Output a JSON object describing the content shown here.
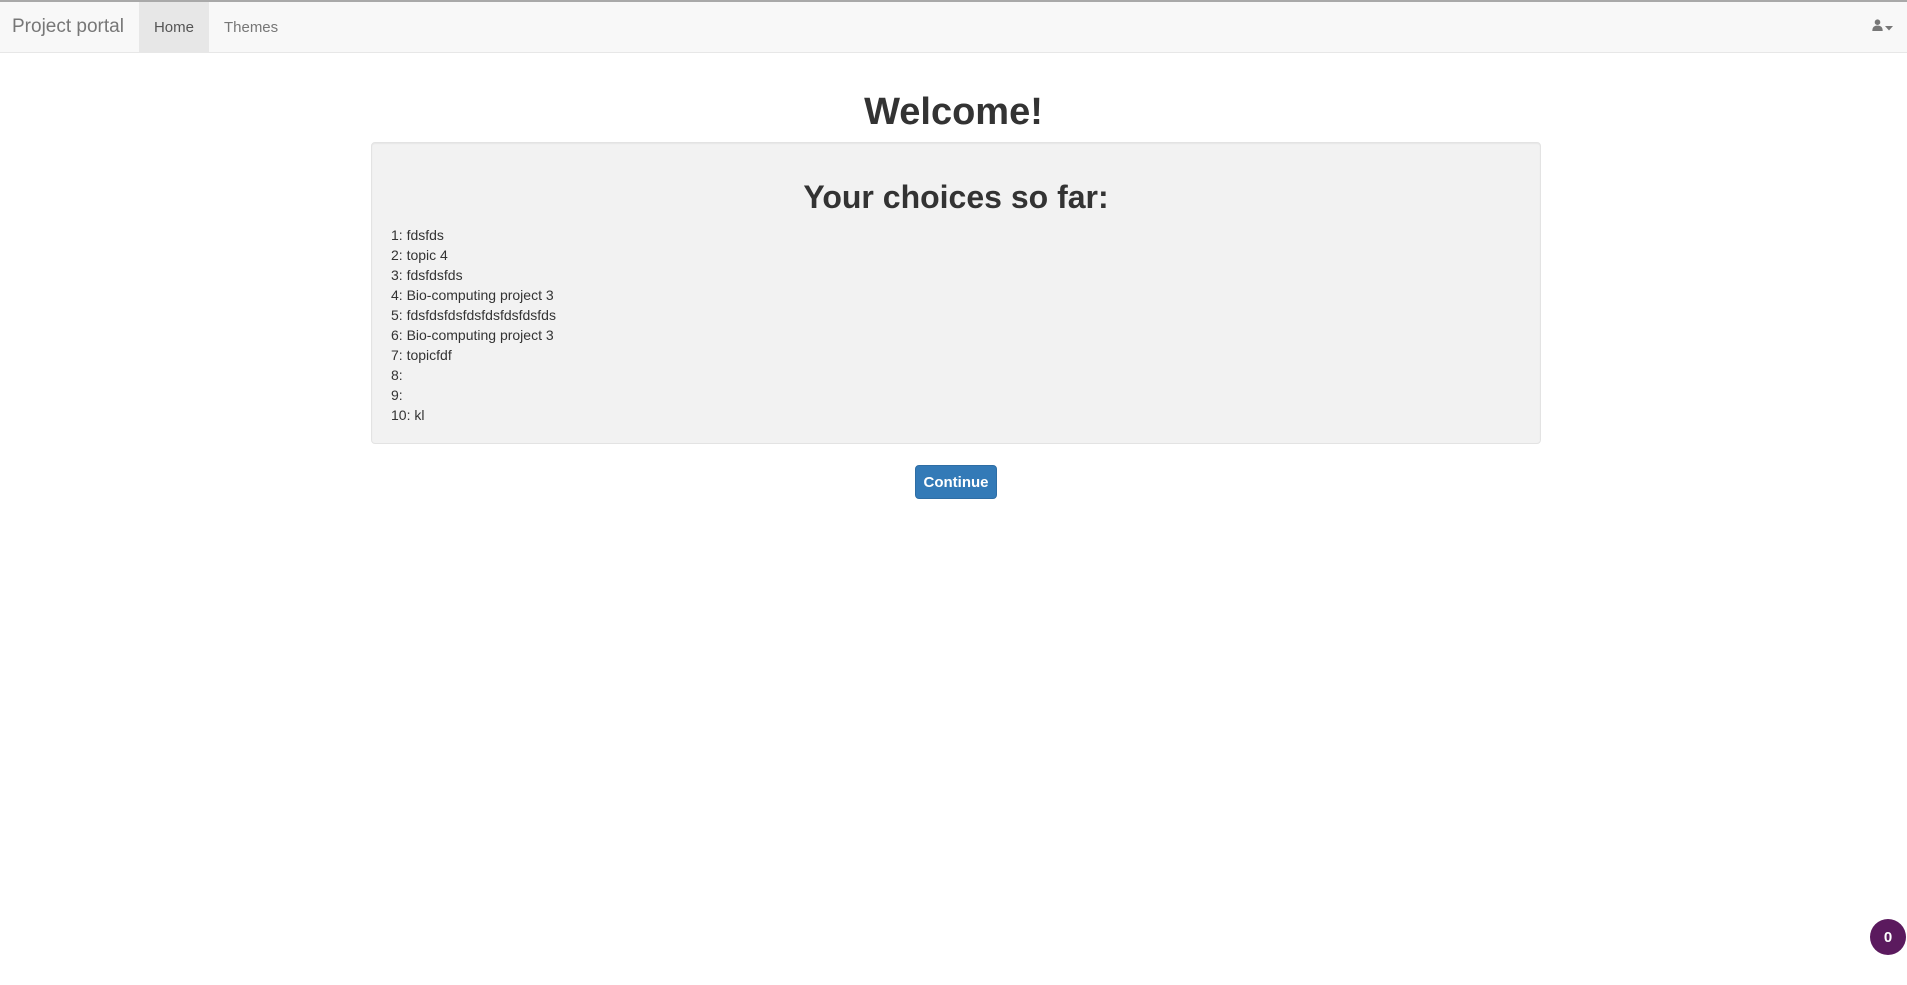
{
  "navbar": {
    "brand": "Project portal",
    "items": [
      {
        "label": "Home",
        "active": true
      },
      {
        "label": "Themes",
        "active": false
      }
    ],
    "user_icon": "user-icon",
    "caret_icon": "caret-down-icon"
  },
  "main": {
    "title": "Welcome!",
    "choices_heading": "Your choices so far:",
    "choices": [
      "1: fdsfds",
      "2: topic 4",
      "3: fdsfdsfds",
      "4: Bio-computing project 3",
      "5: fdsfdsfdsfdsfdsfdsfdsfds",
      "6: Bio-computing project 3",
      "7: topicfdf",
      "8:",
      "9:",
      "10: kl"
    ],
    "continue_label": "Continue"
  },
  "notification_badge": {
    "count": "0",
    "color": "#5b1a5e"
  },
  "colors": {
    "primary": "#337ab7",
    "navbar_bg": "#f8f8f8",
    "well_bg": "#f2f2f2"
  }
}
